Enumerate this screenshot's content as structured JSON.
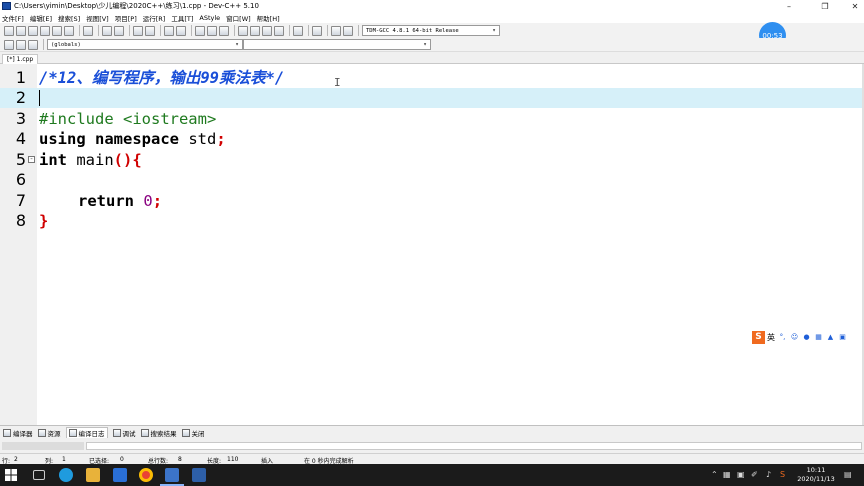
{
  "window": {
    "title": "C:\\Users\\yimin\\Desktop\\少儿编程\\2020C++\\练习\\1.cpp - Dev-C++ 5.10"
  },
  "menu": [
    "文件[F]",
    "编辑[E]",
    "搜索[S]",
    "视图[V]",
    "项目[P]",
    "运行[R]",
    "工具[T]",
    "AStyle",
    "窗口[W]",
    "帮助[H]"
  ],
  "toolbar": {
    "compiler": "TDM-GCC 4.8.1 64-bit Release",
    "scope": "(globals)"
  },
  "timer": "00:53",
  "file_tab": "[*] 1.cpp",
  "editor": {
    "lines": [
      {
        "num": "1",
        "comment": "/*12、编写程序，输出99乘法表*/"
      },
      {
        "num": "2"
      },
      {
        "num": "3",
        "include": "#include <iostream>"
      },
      {
        "num": "4",
        "kw": "using namespace",
        "rest": " std",
        "sym": ";"
      },
      {
        "num": "5",
        "kw": "int",
        "rest": " main",
        "sym": "(){"
      },
      {
        "num": "6"
      },
      {
        "num": "7",
        "kw": "return",
        "num_val": "0",
        "sym": ";"
      },
      {
        "num": "8",
        "sym": "}"
      }
    ]
  },
  "ime": {
    "logo": "S",
    "lang": "英"
  },
  "bottom_tabs": [
    "编译器",
    "资源",
    "编译日志",
    "调试",
    "搜索结果",
    "关闭"
  ],
  "status": {
    "row_label": "行:",
    "row": "2",
    "col_label": "列:",
    "col": "1",
    "selected_label": "已选择:",
    "selected": "0",
    "total_label": "总行数:",
    "total": "8",
    "length_label": "长度:",
    "length": "110",
    "mode": "插入",
    "parse": "在 0 秒内完成解析"
  },
  "taskbar": {
    "time": "10:11",
    "date": "2020/11/13"
  },
  "colors": {
    "current_line": "#d6f0f9",
    "comment": "#1a4fd8",
    "symbol": "#d00000",
    "number": "#8a0080",
    "taskbar": "#1b1b1b",
    "timer": "#2f8ff0"
  }
}
